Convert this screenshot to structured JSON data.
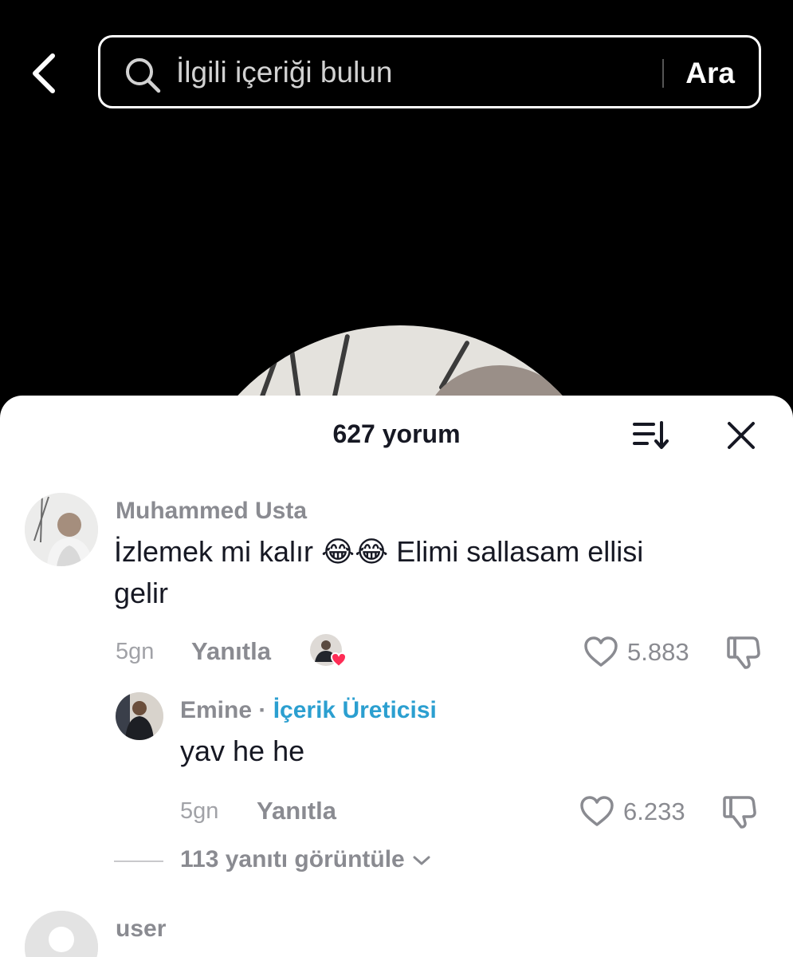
{
  "search": {
    "placeholder": "İlgili içeriği bulun",
    "submit_label": "Ara"
  },
  "sheet": {
    "title": "627 yorum"
  },
  "comments": [
    {
      "user": "Muhammed Usta",
      "text_before": "İzlemek mi kalır",
      "emojis": [
        "😂",
        "😂"
      ],
      "text_after": "Elimi sallasam ellisi",
      "text_line2": "gelir",
      "time": "5gn",
      "reply_label": "Yanıtla",
      "likes": "5.883",
      "liked_by_creator": true
    }
  ],
  "reply": {
    "user": "Emine",
    "separator": "·",
    "badge": "İçerik Üreticisi",
    "text": "yav he he",
    "time": "5gn",
    "reply_label": "Yanıtla",
    "likes": "6.233"
  },
  "view_replies": "113 yanıtı görüntüle",
  "next_comment": {
    "user": "user"
  },
  "colors": {
    "accent_badge": "#2b9fd0",
    "heart_badge": "#fe2c55",
    "text_primary": "#161823",
    "text_secondary": "#8a8b91"
  },
  "icons": [
    "back-arrow-icon",
    "search-icon",
    "sort-icon",
    "close-icon",
    "heart-icon",
    "dislike-icon",
    "chevron-down-icon"
  ]
}
